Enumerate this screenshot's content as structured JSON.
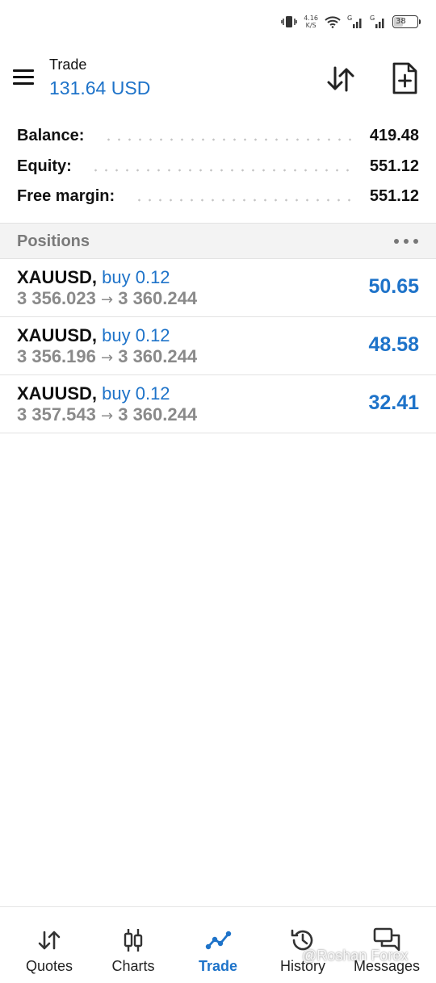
{
  "status_bar": {
    "net_speed_value": "4.16",
    "net_speed_unit": "K/S",
    "battery": "38",
    "icons": [
      "vibrate-icon",
      "wifi-icon",
      "signal-icon",
      "signal-icon",
      "battery-icon"
    ]
  },
  "header": {
    "title": "Trade",
    "balance": "131.64 USD",
    "icons": [
      "menu-icon",
      "sort-icon",
      "new-order-icon"
    ]
  },
  "summary": [
    {
      "label": "Balance:",
      "value": "419.48"
    },
    {
      "label": "Equity:",
      "value": "551.12"
    },
    {
      "label": "Free margin:",
      "value": "551.12"
    }
  ],
  "positions": {
    "title": "Positions",
    "more_icon": "more-horizontal-icon",
    "items": [
      {
        "symbol": "XAUUSD,",
        "direction": "buy 0.12",
        "open_price": "3 356.023",
        "arrow": "→",
        "current_price": "3 360.244",
        "profit": "50.65"
      },
      {
        "symbol": "XAUUSD,",
        "direction": "buy 0.12",
        "open_price": "3 356.196",
        "arrow": "→",
        "current_price": "3 360.244",
        "profit": "48.58"
      },
      {
        "symbol": "XAUUSD,",
        "direction": "buy 0.12",
        "open_price": "3 357.543",
        "arrow": "→",
        "current_price": "3 360.244",
        "profit": "32.41"
      }
    ]
  },
  "bottom_nav": {
    "active": "Trade",
    "items": [
      {
        "label": "Quotes",
        "icon": "quotes-icon"
      },
      {
        "label": "Charts",
        "icon": "charts-icon"
      },
      {
        "label": "Trade",
        "icon": "trade-icon"
      },
      {
        "label": "History",
        "icon": "history-icon"
      },
      {
        "label": "Messages",
        "icon": "messages-icon"
      }
    ]
  },
  "watermark": "@Roshan Forex",
  "colors": {
    "accent": "#1e73c9",
    "text": "#111111",
    "muted": "#8a8a8a",
    "section_bg": "#f3f3f3",
    "divider": "#e2e2e2"
  }
}
